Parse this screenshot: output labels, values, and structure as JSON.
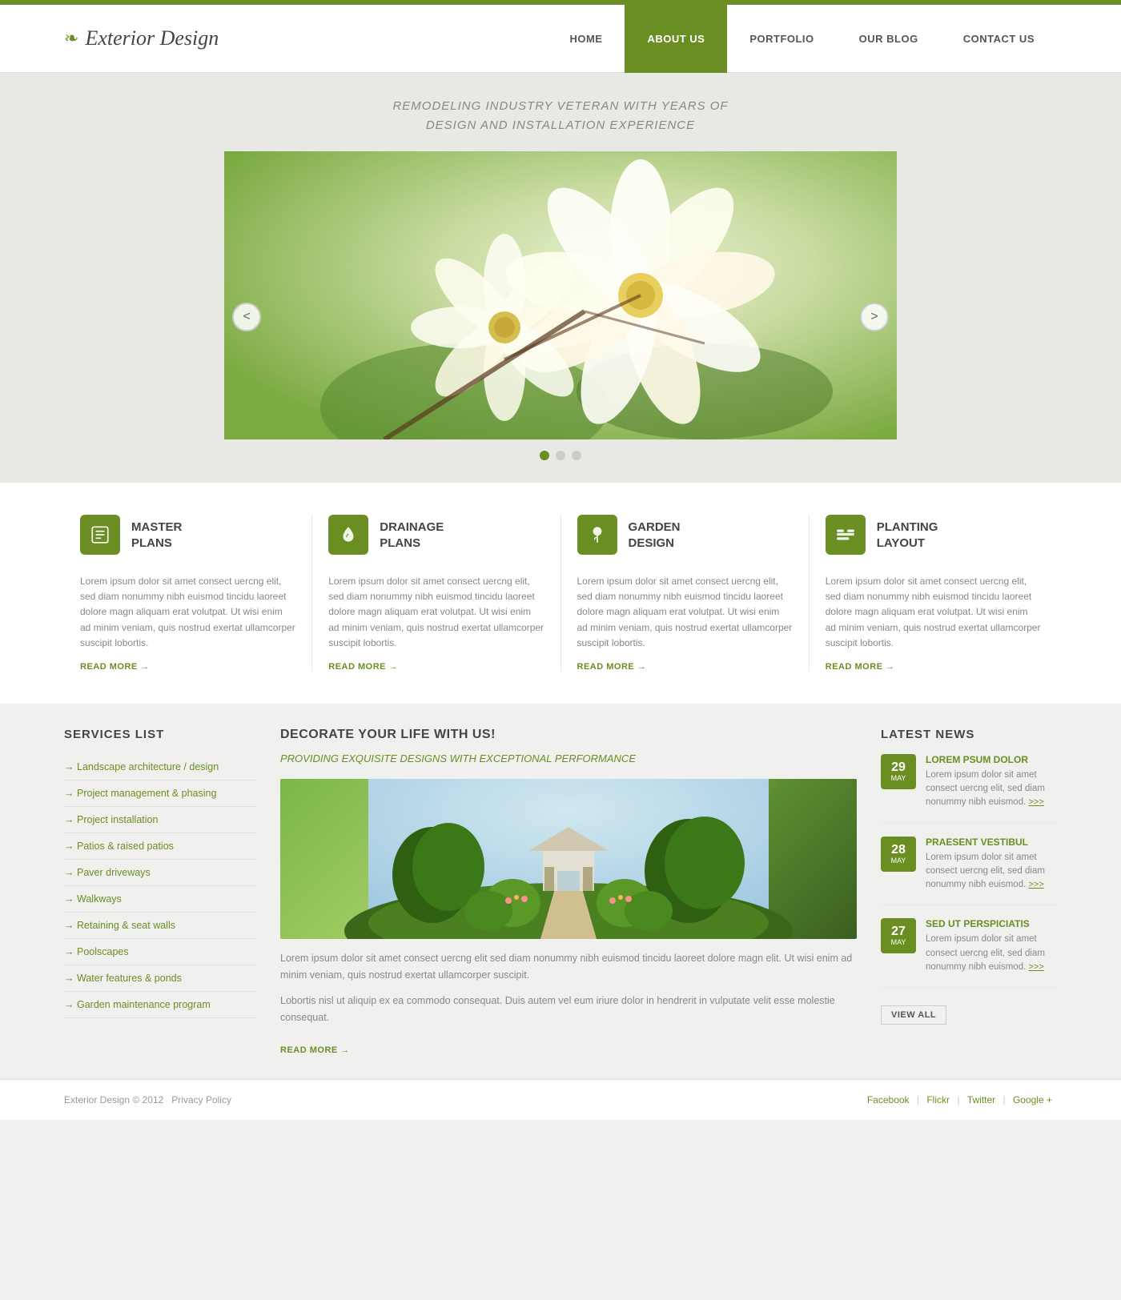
{
  "topbar": {},
  "header": {
    "logo_icon": "❧",
    "logo_text": "Exterior Design",
    "nav": [
      {
        "label": "HOME",
        "href": "#",
        "active": false
      },
      {
        "label": "ABOUT US",
        "href": "#",
        "active": true
      },
      {
        "label": "PORTFOLIO",
        "href": "#",
        "active": false
      },
      {
        "label": "OUR BLOG",
        "href": "#",
        "active": false
      },
      {
        "label": "CONTACT US",
        "href": "#",
        "active": false
      }
    ]
  },
  "hero": {
    "subtitle_line1": "REMODELING INDUSTRY VETERAN WITH YEARS OF",
    "subtitle_line2": "DESIGN AND INSTALLATION EXPERIENCE"
  },
  "slider": {
    "prev_label": "<",
    "next_label": ">",
    "dots": [
      true,
      false,
      false
    ]
  },
  "services": [
    {
      "title_line1": "MASTER",
      "title_line2": "PLANS",
      "desc": "Lorem ipsum dolor sit amet consect uercng elit, sed diam nonummy nibh euismod tincidu laoreet dolore magn aliquam erat volutpat. Ut wisi enim ad minim veniam, quis nostrud exertat ullamcorper suscipit lobortis.",
      "read_more": "READ MORE"
    },
    {
      "title_line1": "DRAINAGE",
      "title_line2": "PLANS",
      "desc": "Lorem ipsum dolor sit amet consect uercng elit, sed diam nonummy nibh euismod tincidu laoreet dolore magn aliquam erat volutpat. Ut wisi enim ad minim veniam, quis nostrud exertat ullamcorper suscipit lobortis.",
      "read_more": "READ MORE"
    },
    {
      "title_line1": "GARDEN",
      "title_line2": "DESIGN",
      "desc": "Lorem ipsum dolor sit amet consect uercng elit, sed diam nonummy nibh euismod tincidu laoreet dolore magn aliquam erat volutpat. Ut wisi enim ad minim veniam, quis nostrud exertat ullamcorper suscipit lobortis.",
      "read_more": "READ MORE"
    },
    {
      "title_line1": "PLANTING",
      "title_line2": "LAYOUT",
      "desc": "Lorem ipsum dolor sit amet consect uercng elit, sed diam nonummy nibh euismod tincidu laoreet dolore magn aliquam erat volutpat. Ut wisi enim ad minim veniam, quis nostrud exertat ullamcorper suscipit lobortis.",
      "read_more": "READ MORE"
    }
  ],
  "services_list": {
    "title": "SERVICES LIST",
    "items": [
      {
        "label": "Landscape architecture / design"
      },
      {
        "label": "Project management & phasing"
      },
      {
        "label": "Project installation"
      },
      {
        "label": "Patios & raised patios"
      },
      {
        "label": "Paver driveways"
      },
      {
        "label": "Walkways"
      },
      {
        "label": "Retaining & seat walls"
      },
      {
        "label": "Poolscapes"
      },
      {
        "label": "Water features & ponds"
      },
      {
        "label": "Garden maintenance program"
      }
    ]
  },
  "decorate": {
    "title": "DECORATE YOUR LIFE WITH US!",
    "subtitle": "PROVIDING EXQUISITE DESIGNS WITH EXCEPTIONAL PERFORMANCE",
    "para1": "Lorem ipsum dolor sit amet consect uercng elit sed diam nonummy nibh euismod tincidu laoreet dolore magn elit. Ut wisi enim ad minim veniam, quis nostrud exertat ullamcorper suscipit.",
    "para2": "Lobortis nisl ut aliquip ex ea commodo consequat. Duis autem vel eum iriure dolor in hendrerit in vulputate velit esse molestie consequat.",
    "read_more": "READ MORE"
  },
  "latest_news": {
    "title": "LATEST NEWS",
    "items": [
      {
        "day": "29",
        "month": "MAY",
        "headline": "LOREM PSUM DOLOR",
        "desc": "Lorem ipsum dolor sit amet consect uercng elit, sed diam nonummy nibh euismod.",
        "more": ">>>"
      },
      {
        "day": "28",
        "month": "MAY",
        "headline": "PRAESENT VESTIBUL",
        "desc": "Lorem ipsum dolor sit amet consect uercng elit, sed diam nonummy nibh euismod.",
        "more": ">>>"
      },
      {
        "day": "27",
        "month": "MAY",
        "headline": "SED UT PERSPICIATIS",
        "desc": "Lorem ipsum dolor sit amet consect uercng elit, sed diam nonummy nibh euismod.",
        "more": ">>>"
      }
    ],
    "view_all": "VIEW ALL"
  },
  "footer": {
    "copyright": "Exterior Design © 2012",
    "privacy": "Privacy Policy",
    "social": [
      "Facebook",
      "Flickr",
      "Twitter",
      "Google +"
    ]
  }
}
